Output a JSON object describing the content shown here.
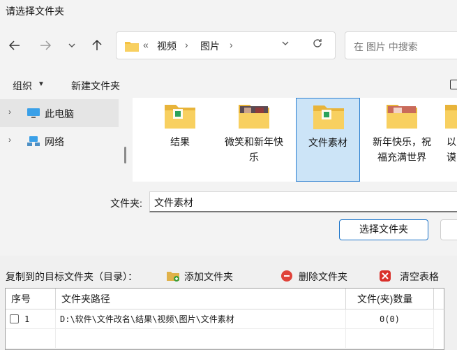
{
  "dialog": {
    "title": "请选择文件夹",
    "address": {
      "overflow": "«",
      "crumbs": [
        "视频",
        "图片"
      ],
      "separator": "›"
    },
    "search_placeholder": "在 图片 中搜索",
    "commands": {
      "organize": "组织",
      "new_folder": "新建文件夹"
    },
    "nav_tree": [
      {
        "label": "此电脑",
        "icon": "monitor-icon"
      },
      {
        "label": "网络",
        "icon": "network-icon"
      }
    ],
    "files": [
      {
        "label": "结果",
        "icon": "folder-icon"
      },
      {
        "label": "微笑和新年快乐",
        "icon": "image-folder-icon"
      },
      {
        "label": "文件素材",
        "icon": "folder-icon",
        "selected": true
      },
      {
        "label": "新年快乐，祝福充满世界",
        "icon": "image-folder-icon"
      },
      {
        "label": "以 谟",
        "icon": "folder-icon"
      }
    ],
    "folder_field_label": "文件夹:",
    "folder_field_value": "文件素材",
    "select_button": "选择文件夹"
  },
  "panel": {
    "target_label": "复制到的目标文件夹（目录）：",
    "add_folder": "添加文件夹",
    "delete_folder": "删除文件夹",
    "clear_table": "清空表格",
    "columns": [
      "序号",
      "文件夹路径",
      "文件(夹)数量"
    ],
    "rows": [
      {
        "index": "1",
        "path": "D:\\软件\\文件改名\\结果\\视频\\图片\\文件素材",
        "count": "0(0)"
      }
    ]
  },
  "colors": {
    "accent": "#1a73c9",
    "selection": "#cce4f7",
    "folder": "#f5c242"
  }
}
